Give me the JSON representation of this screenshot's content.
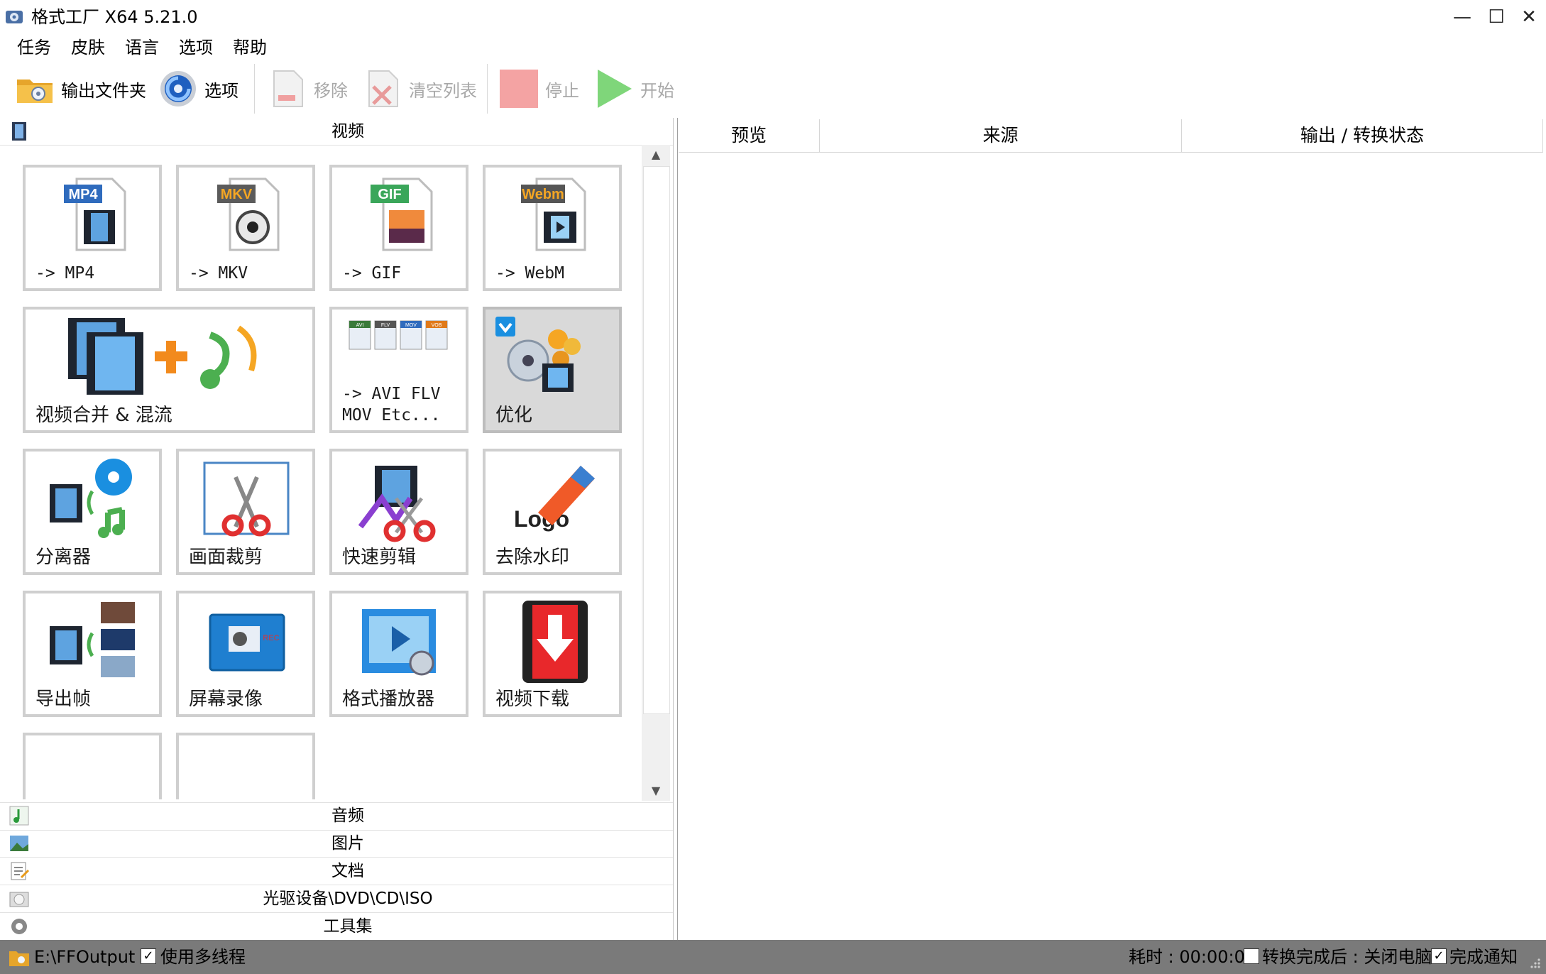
{
  "window": {
    "title": "格式工厂 X64 5.21.0",
    "minimize": "—",
    "maximize": "☐",
    "close": "✕"
  },
  "menu": [
    "任务",
    "皮肤",
    "语言",
    "选项",
    "帮助"
  ],
  "toolbar": {
    "output_folder": "输出文件夹",
    "options": "选项",
    "remove": "移除",
    "clear_list": "清空列表",
    "stop": "停止",
    "start": "开始"
  },
  "categories": {
    "video": "视频",
    "audio": "音频",
    "picture": "图片",
    "document": "文档",
    "rom": "光驱设备\\DVD\\CD\\ISO",
    "toolbox": "工具集"
  },
  "video_tiles": {
    "mp4": {
      "label": "-> MP4",
      "badge": "MP4"
    },
    "mkv": {
      "label": "-> MKV",
      "badge": "MKV"
    },
    "gif": {
      "label": "-> GIF",
      "badge": "GIF"
    },
    "webm": {
      "label": "-> WebM",
      "badge": "Webm"
    },
    "merge": {
      "label": "视频合并 & 混流"
    },
    "other": {
      "label": "-> AVI FLV\nMOV Etc...",
      "badges": [
        "AVI",
        "FLV",
        "MOV",
        "VOB"
      ]
    },
    "optimize": {
      "label": "优化"
    },
    "splitter": {
      "label": "分离器"
    },
    "crop": {
      "label": "画面裁剪"
    },
    "quick_clip": {
      "label": "快速剪辑"
    },
    "remove_logo": {
      "label": "去除水印",
      "logo_text": "Logo"
    },
    "export_frames": {
      "label": "导出帧"
    },
    "screen_record": {
      "label": "屏幕录像",
      "rec_text": "REC"
    },
    "player": {
      "label": "格式播放器"
    },
    "download": {
      "label": "视频下载"
    }
  },
  "task_list": {
    "columns": [
      "预览",
      "来源",
      "输出 / 转换状态"
    ]
  },
  "status": {
    "output_path": "E:\\FFOutput",
    "multithread_label": "使用多线程",
    "multithread_checked": true,
    "elapsed": "耗时 : 00:00:00",
    "after_convert": "转换完成后 : 关闭电脑",
    "after_convert_checked": false,
    "notify": "完成通知",
    "notify_checked": true
  },
  "colors": {
    "status_bar": "#7a7a7a",
    "tile_border": "#cfcfcf",
    "selected_tile": "#d9d9d9",
    "stop_red": "#f4a3a3",
    "start_green": "#7fd67a"
  }
}
